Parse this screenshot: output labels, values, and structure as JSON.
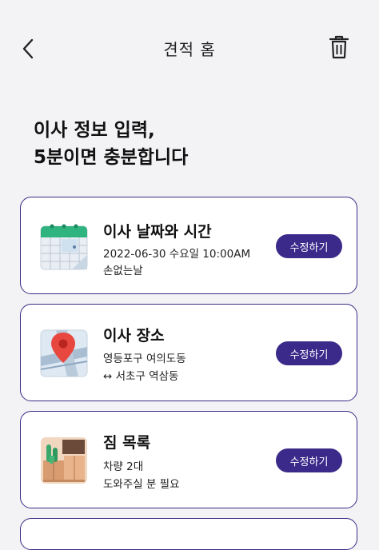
{
  "header": {
    "title": "견적 홈",
    "back_icon": "chevron-left-icon",
    "delete_icon": "trash-icon"
  },
  "headline": {
    "line1": "이사 정보 입력,",
    "line2": "5분이면 충분합니다"
  },
  "cards": [
    {
      "title": "이사 날짜와 시간",
      "line1": "2022-06-30 수요일 10:00AM",
      "line2": "손없는날",
      "button": "수정하기",
      "icon": "calendar-icon"
    },
    {
      "title": "이사 장소",
      "line1": "영등포구 여의도동",
      "line2": "↔ 서초구 역삼동",
      "button": "수정하기",
      "icon": "map-pin-icon"
    },
    {
      "title": "짐 목록",
      "line1": "차량 2대",
      "line2": "도와주실 분 필요",
      "button": "수정하기",
      "icon": "boxes-icon"
    }
  ],
  "colors": {
    "accent": "#3b2a8a",
    "background": "#f3f3f5",
    "card_border": "#3e2a86"
  }
}
